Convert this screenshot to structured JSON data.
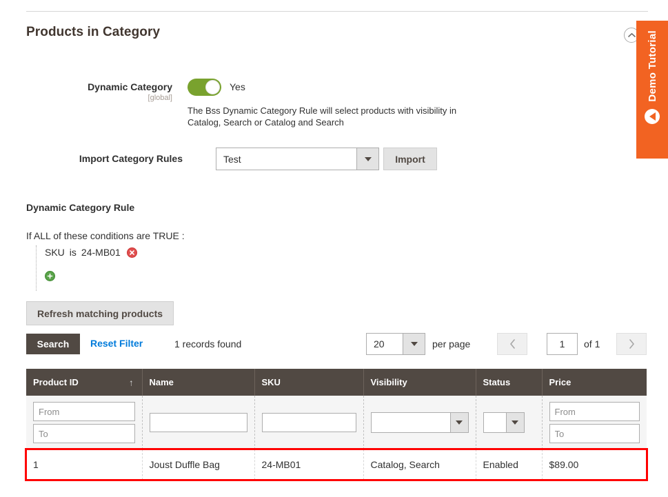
{
  "section": {
    "title": "Products in Category",
    "collapse_icon": "chevron-up-icon"
  },
  "demo_tab": {
    "label": "Demo Tutorial",
    "arrow_icon": "triangle-left-icon",
    "color": "#f26322"
  },
  "dynamic_category": {
    "label": "Dynamic Category",
    "scope": "[global]",
    "toggle_value": "Yes",
    "toggle_on": true,
    "toggle_color": "#79a22e",
    "help_text": "The Bss Dynamic Category Rule will select products with visibility in Catalog, Search or Catalog and Search"
  },
  "import_rules": {
    "label": "Import Category Rules",
    "selected": "Test",
    "button": "Import"
  },
  "rule": {
    "title": "Dynamic Category Rule",
    "intro_if": "If",
    "intro_all": "ALL",
    "intro_mid": "of these conditions are",
    "intro_true": "TRUE",
    "intro_colon": ":",
    "condition": {
      "attribute": "SKU",
      "operator": "is",
      "value": "24-MB01",
      "remove_icon": "remove-circle-icon"
    },
    "add_icon": "add-circle-icon"
  },
  "toolbar": {
    "refresh_label": "Refresh matching products",
    "search_label": "Search",
    "reset_label": "Reset Filter",
    "records_found": "1 records found"
  },
  "pagination": {
    "per_page_value": "20",
    "per_page_label": "per page",
    "prev_icon": "chevron-left-icon",
    "next_icon": "chevron-right-icon",
    "current_page": "1",
    "of_pages": "of 1"
  },
  "grid": {
    "columns": [
      {
        "label": "Product ID",
        "sorted": true,
        "sort_icon": "arrow-up-icon"
      },
      {
        "label": "Name",
        "sorted": false
      },
      {
        "label": "SKU",
        "sorted": false
      },
      {
        "label": "Visibility",
        "sorted": false
      },
      {
        "label": "Status",
        "sorted": false
      },
      {
        "label": "Price",
        "sorted": false
      }
    ],
    "filters": {
      "product_id_from": "From",
      "product_id_to": "To",
      "name": "",
      "sku": "",
      "visibility": "",
      "status": "",
      "price_from": "From",
      "price_to": "To"
    },
    "rows": [
      {
        "product_id": "1",
        "name": "Joust Duffle Bag",
        "sku": "24-MB01",
        "visibility": "Catalog, Search",
        "status": "Enabled",
        "price": "$89.00",
        "highlighted": true,
        "highlight_color": "#ff0000"
      }
    ]
  }
}
